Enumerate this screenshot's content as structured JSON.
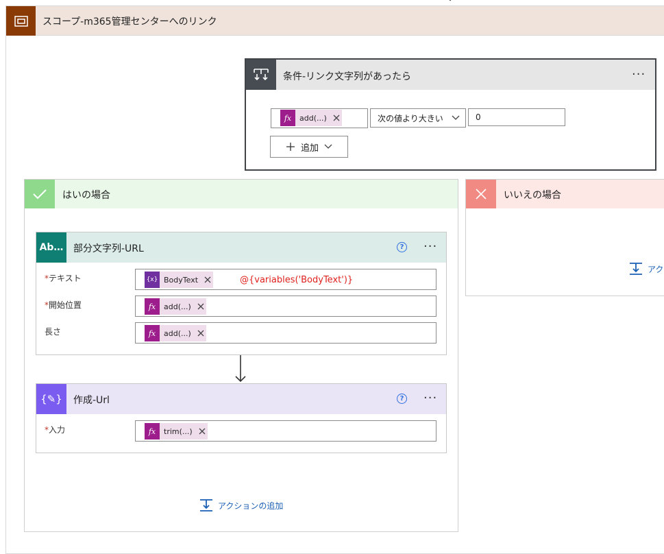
{
  "scope": {
    "title": "スコープ-m365管理センターへのリンク",
    "icon": "scope-icon"
  },
  "condition": {
    "title": "条件-リンク文字列があったら",
    "menu": "···",
    "token": "add(...)",
    "operator": "次の値より大きい",
    "value": "0",
    "add_label": "追加"
  },
  "yes_branch": {
    "title": "はいの場合",
    "add_action": "アクションの追加"
  },
  "no_branch": {
    "title": "いいえの場合",
    "add_action": "アク"
  },
  "substring": {
    "icon_text": "Ab…",
    "title": "部分文字列-URL",
    "help": "?",
    "menu": "···",
    "fields": [
      {
        "label": "テキスト",
        "required": "*",
        "token": "BodyText"
      },
      {
        "label": "開始位置",
        "required": "*",
        "token": "add(...)"
      },
      {
        "label": "長さ",
        "token": "add(...)"
      }
    ],
    "note": "@{variables('BodyText')}"
  },
  "compose": {
    "icon_text": "{✎}",
    "title": "作成-Url",
    "help": "?",
    "menu": "···",
    "field": {
      "label": "入力",
      "required": "*",
      "token": "trim(...)"
    }
  },
  "tokens": {
    "fx": "fx",
    "var": "{x}"
  },
  "colors": {
    "scope_accent": "#8a3a05",
    "condition_accent": "#474c52",
    "yes_accent": "#8ed98c",
    "no_accent": "#f08a83",
    "substring_accent": "#0e7f72",
    "compose_accent": "#7a5cf0",
    "expression_token": "#9c1d8b",
    "link": "#1a5fb4",
    "annotation": "#e0201c"
  }
}
